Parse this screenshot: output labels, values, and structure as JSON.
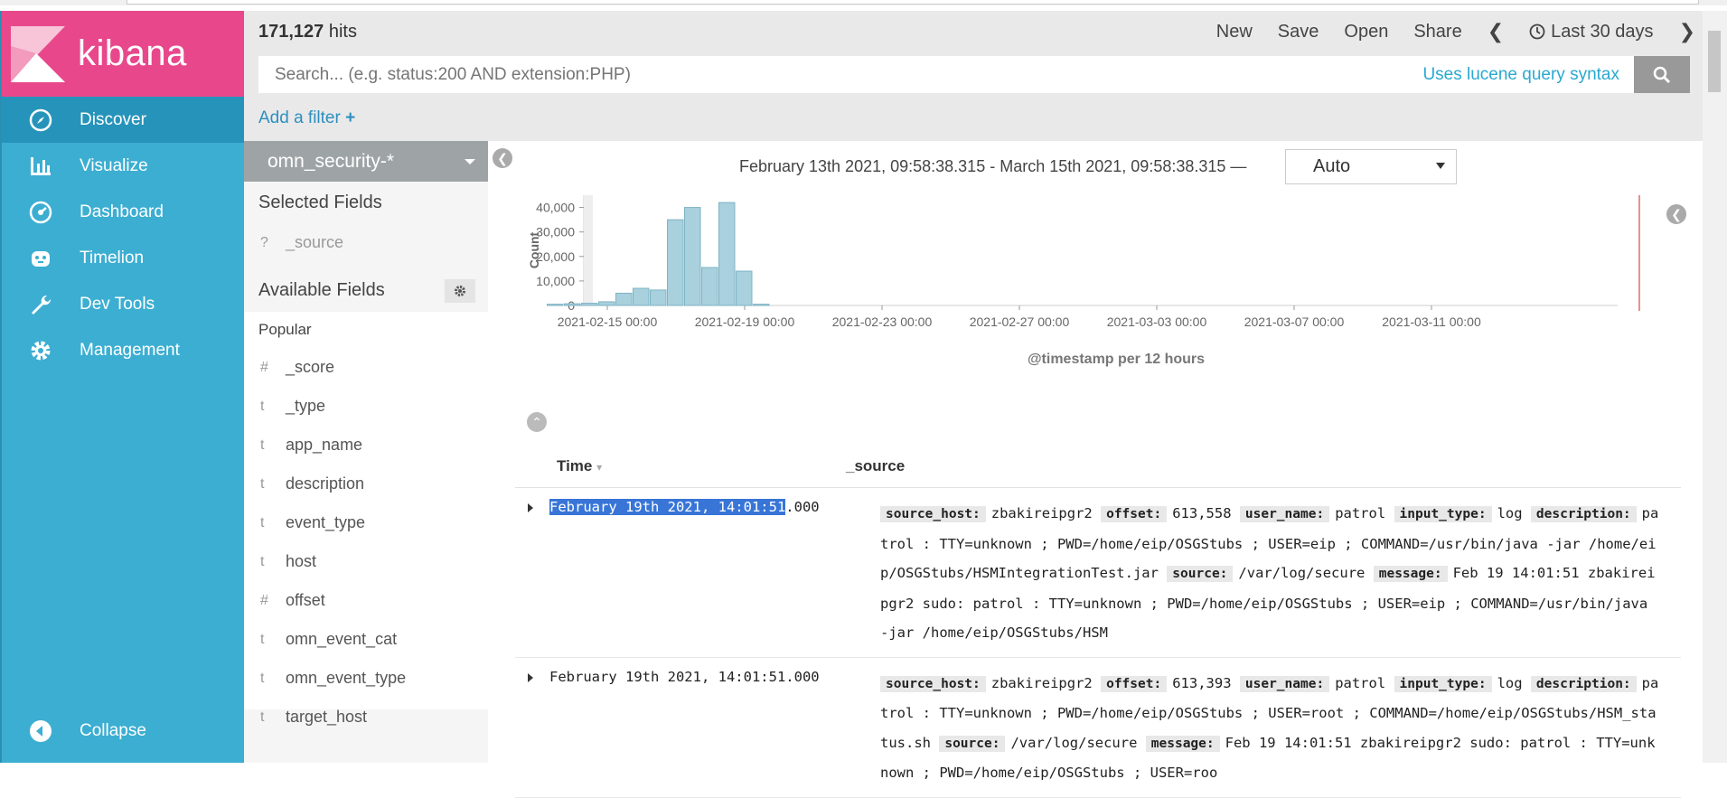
{
  "header": {
    "hits_count": "171,127",
    "hits_label": "hits",
    "menu": {
      "new": "New",
      "save": "Save",
      "open": "Open",
      "share": "Share",
      "time_range": "Last 30 days"
    },
    "search_placeholder": "Search... (e.g. status:200 AND extension:PHP)",
    "lucene_link": "Uses lucene query syntax",
    "add_filter": "Add a filter"
  },
  "sidebar": {
    "logo": "kibana",
    "items": [
      {
        "label": "Discover",
        "icon": "compass-icon"
      },
      {
        "label": "Visualize",
        "icon": "bar-chart-icon"
      },
      {
        "label": "Dashboard",
        "icon": "dashboard-icon"
      },
      {
        "label": "Timelion",
        "icon": "timelion-icon"
      },
      {
        "label": "Dev Tools",
        "icon": "wrench-icon"
      },
      {
        "label": "Management",
        "icon": "gear-icon"
      }
    ],
    "collapse": "Collapse"
  },
  "fields_panel": {
    "index_pattern": "omn_security-*",
    "selected_title": "Selected Fields",
    "selected": [
      {
        "type": "?",
        "name": "_source"
      }
    ],
    "available_title": "Available Fields",
    "popular_title": "Popular",
    "available": [
      {
        "type": "#",
        "name": "_score"
      },
      {
        "type": "t",
        "name": "_type"
      },
      {
        "type": "t",
        "name": "app_name"
      },
      {
        "type": "t",
        "name": "description"
      },
      {
        "type": "t",
        "name": "event_type"
      },
      {
        "type": "t",
        "name": "host"
      },
      {
        "type": "#",
        "name": "offset"
      },
      {
        "type": "t",
        "name": "omn_event_cat"
      },
      {
        "type": "t",
        "name": "omn_event_type"
      },
      {
        "type": "t",
        "name": "target_host"
      }
    ]
  },
  "histogram": {
    "range_text": "February 13th 2021, 09:58:38.315 - March 15th 2021, 09:58:38.315 —",
    "interval": "Auto"
  },
  "chart_data": {
    "type": "bar",
    "title": "",
    "xlabel": "@timestamp per 12 hours",
    "ylabel": "Count",
    "ylim": [
      0,
      45000
    ],
    "y_ticks": [
      "0",
      "10,000",
      "20,000",
      "30,000",
      "40,000"
    ],
    "x_ticks": [
      "2021-02-15 00:00",
      "2021-02-19 00:00",
      "2021-02-23 00:00",
      "2021-02-27 00:00",
      "2021-03-03 00:00",
      "2021-03-07 00:00",
      "2021-03-11 00:00"
    ],
    "categories": [
      "2021-02-14 12:00",
      "2021-02-15 00:00",
      "2021-02-15 12:00",
      "2021-02-16 00:00",
      "2021-02-16 12:00",
      "2021-02-17 00:00",
      "2021-02-17 12:00",
      "2021-02-18 00:00",
      "2021-02-18 12:00",
      "2021-02-19 00:00",
      "2021-02-19 12:00",
      "2021-02-20 00:00",
      "2021-02-20 12:00"
    ],
    "values": [
      500,
      700,
      900,
      1500,
      5000,
      7000,
      6300,
      35000,
      40000,
      15500,
      42000,
      14000,
      500
    ],
    "bar_color": "#a8d0dd"
  },
  "documents": {
    "headers": {
      "time": "Time",
      "source": "_source"
    },
    "rows": [
      {
        "time_selected": "February 19th 2021, 14:01:51",
        "time_rest": ".000",
        "fields": [
          {
            "k": "source_host:",
            "v": "zbakireipgr2"
          },
          {
            "k": "offset:",
            "v": "613,558"
          },
          {
            "k": "user_name:",
            "v": "patrol"
          },
          {
            "k": "input_type:",
            "v": "log"
          },
          {
            "k": "description:",
            "v": "patrol : TTY=unknown ; PWD=/home/eip/OSGStubs ; USER=eip ; COMMAND=/usr/bin/java -jar /home/eip/OSGStubs/HSMIntegrationTest.jar"
          },
          {
            "k": "source:",
            "v": "/var/log/secure"
          },
          {
            "k": "message:",
            "v": "Feb 19 14:01:51 zbakireipgr2 sudo: patrol : TTY=unknown ; PWD=/home/eip/OSGStubs ; USER=eip ; COMMAND=/usr/bin/java -jar /home/eip/OSGStubs/HSM"
          }
        ]
      },
      {
        "time_selected": "",
        "time_rest": "February 19th 2021, 14:01:51.000",
        "fields": [
          {
            "k": "source_host:",
            "v": "zbakireipgr2"
          },
          {
            "k": "offset:",
            "v": "613,393"
          },
          {
            "k": "user_name:",
            "v": "patrol"
          },
          {
            "k": "input_type:",
            "v": "log"
          },
          {
            "k": "description:",
            "v": "patrol : TTY=unknown ; PWD=/home/eip/OSGStubs ; USER=root ; COMMAND=/home/eip/OSGStubs/HSM_status.sh"
          },
          {
            "k": "source:",
            "v": "/var/log/secure"
          },
          {
            "k": "message:",
            "v": "Feb 19 14:01:51 zbakireipgr2 sudo: patrol : TTY=unknown ; PWD=/home/eip/OSGStubs ; USER=roo"
          }
        ]
      }
    ]
  },
  "colors": {
    "sidebar": "#3caed2",
    "sidebar_active": "#2694ba",
    "logo_bg": "#e8488b",
    "link": "#2aa9d0",
    "bar": "#a8d0dd"
  }
}
